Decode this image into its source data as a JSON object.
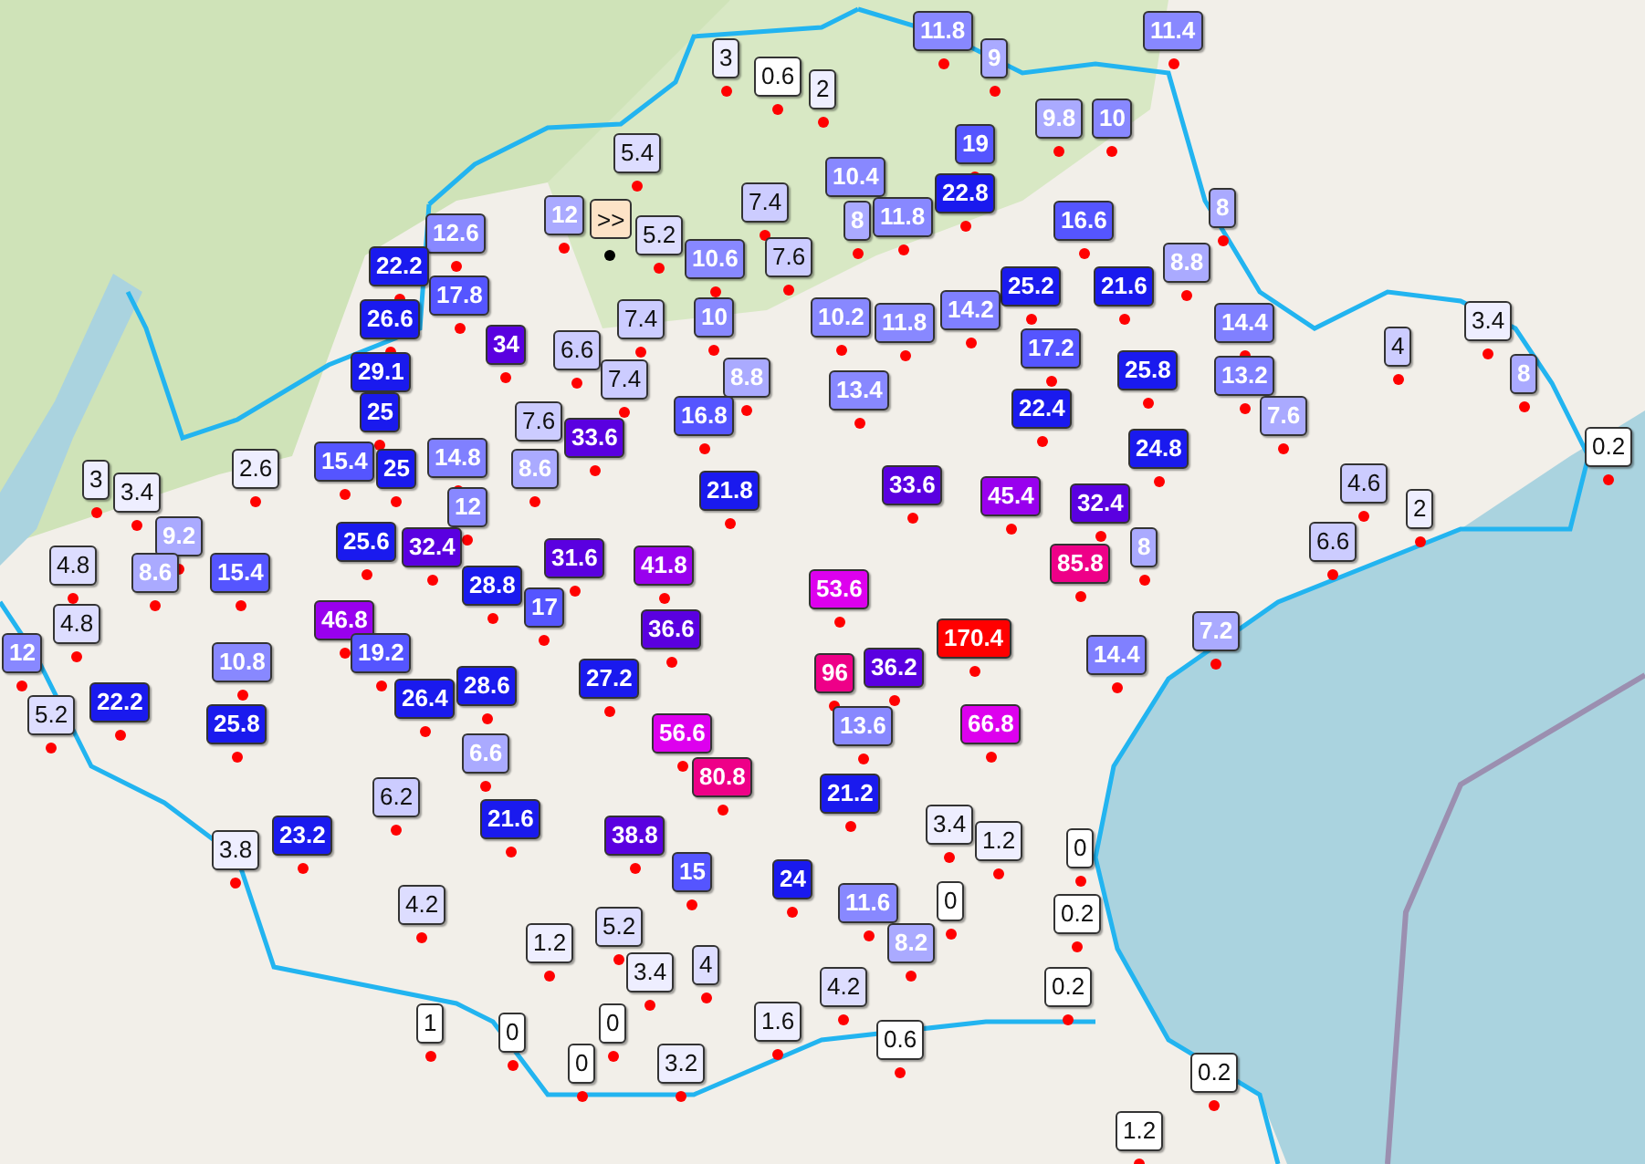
{
  "map": {
    "expand_button": {
      "label": ">>"
    },
    "markers": [
      {
        "value": "11.8",
        "color": "#8888ff"
      },
      {
        "value": "11.4",
        "color": "#8888ff"
      },
      {
        "value": "3",
        "color": "#eeeeff"
      },
      {
        "value": "0.6",
        "color": "#ffffff"
      },
      {
        "value": "9",
        "color": "#aaaaff"
      },
      {
        "value": "2",
        "color": "#eeeeff"
      },
      {
        "value": "9.8",
        "color": "#aaaaff"
      },
      {
        "value": "10",
        "color": "#8888ff"
      },
      {
        "value": "5.4",
        "color": "#ddddff"
      },
      {
        "value": "19",
        "color": "#5555ff"
      },
      {
        "value": "10.4",
        "color": "#8888ff"
      },
      {
        "value": "22.8",
        "color": "#1a1aee"
      },
      {
        "value": "12",
        "color": "#aaaaff"
      },
      {
        "value": "7.4",
        "color": "#ccccff"
      },
      {
        "value": "8",
        "color": "#aaaaff"
      },
      {
        "value": "11.8",
        "color": "#8888ff"
      },
      {
        "value": "16.6",
        "color": "#5555ff"
      },
      {
        "value": "8",
        "color": "#aaaaff"
      },
      {
        "value": "12.6",
        "color": "#8888ff"
      },
      {
        "value": "5.2",
        "color": "#ddddff"
      },
      {
        "value": "22.2",
        "color": "#1a1aee"
      },
      {
        "value": "10.6",
        "color": "#8888ff"
      },
      {
        "value": "7.6",
        "color": "#ccccff"
      },
      {
        "value": "8.8",
        "color": "#aaaaff"
      },
      {
        "value": "17.8",
        "color": "#5555ff"
      },
      {
        "value": "25.2",
        "color": "#1a1aee"
      },
      {
        "value": "21.6",
        "color": "#1a1aee"
      },
      {
        "value": "26.6",
        "color": "#1a1aee"
      },
      {
        "value": "7.4",
        "color": "#ccccff"
      },
      {
        "value": "10",
        "color": "#8888ff"
      },
      {
        "value": "10.2",
        "color": "#8888ff"
      },
      {
        "value": "11.8",
        "color": "#8888ff"
      },
      {
        "value": "14.2",
        "color": "#8080ff"
      },
      {
        "value": "14.4",
        "color": "#8080ff"
      },
      {
        "value": "3.4",
        "color": "#eeeeff"
      },
      {
        "value": "34",
        "color": "#5a00e0"
      },
      {
        "value": "6.6",
        "color": "#ccccff"
      },
      {
        "value": "17.2",
        "color": "#5555ff"
      },
      {
        "value": "4",
        "color": "#ccccff"
      },
      {
        "value": "29.1",
        "color": "#1a1aee"
      },
      {
        "value": "7.4",
        "color": "#ccccff"
      },
      {
        "value": "8.8",
        "color": "#aaaaff"
      },
      {
        "value": "13.4",
        "color": "#8888ff"
      },
      {
        "value": "25.8",
        "color": "#1a1aee"
      },
      {
        "value": "13.2",
        "color": "#8080ff"
      },
      {
        "value": "8",
        "color": "#aaaaff"
      },
      {
        "value": "25",
        "color": "#1a1aee"
      },
      {
        "value": "7.6",
        "color": "#ccccff"
      },
      {
        "value": "16.8",
        "color": "#5555ff"
      },
      {
        "value": "22.4",
        "color": "#1a1aee"
      },
      {
        "value": "7.6",
        "color": "#aaaaff"
      },
      {
        "value": "14.8",
        "color": "#8080ff"
      },
      {
        "value": "33.6",
        "color": "#5a00e0"
      },
      {
        "value": "24.8",
        "color": "#1a1aee"
      },
      {
        "value": "0.2",
        "color": "#ffffff"
      },
      {
        "value": "3",
        "color": "#eeeeff"
      },
      {
        "value": "2.6",
        "color": "#eeeeff"
      },
      {
        "value": "15.4",
        "color": "#5555ff"
      },
      {
        "value": "25",
        "color": "#1a1aee"
      },
      {
        "value": "8.6",
        "color": "#aaaaff"
      },
      {
        "value": "3.4",
        "color": "#eeeeff"
      },
      {
        "value": "21.8",
        "color": "#1a1aee"
      },
      {
        "value": "33.6",
        "color": "#5a00e0"
      },
      {
        "value": "45.4",
        "color": "#9900ee"
      },
      {
        "value": "32.4",
        "color": "#5a00e0"
      },
      {
        "value": "4.6",
        "color": "#ccccff"
      },
      {
        "value": "12",
        "color": "#8888ff"
      },
      {
        "value": "2",
        "color": "#eeeeff"
      },
      {
        "value": "9.2",
        "color": "#aaaaff"
      },
      {
        "value": "25.6",
        "color": "#1a1aee"
      },
      {
        "value": "32.4",
        "color": "#5a00e0"
      },
      {
        "value": "8",
        "color": "#aaaaff"
      },
      {
        "value": "6.6",
        "color": "#ccccff"
      },
      {
        "value": "4.8",
        "color": "#ddddff"
      },
      {
        "value": "8.6",
        "color": "#aaaaff"
      },
      {
        "value": "15.4",
        "color": "#5555ff"
      },
      {
        "value": "31.6",
        "color": "#5a00e0"
      },
      {
        "value": "41.8",
        "color": "#9900ee"
      },
      {
        "value": "85.8",
        "color": "#ee0088"
      },
      {
        "value": "28.8",
        "color": "#1a1aee"
      },
      {
        "value": "53.6",
        "color": "#dd00ee"
      },
      {
        "value": "4.8",
        "color": "#ddddff"
      },
      {
        "value": "46.8",
        "color": "#9900ee"
      },
      {
        "value": "17",
        "color": "#5555ff"
      },
      {
        "value": "36.6",
        "color": "#5a00e0"
      },
      {
        "value": "170.4",
        "color": "#ff0000"
      },
      {
        "value": "7.2",
        "color": "#aaaaff"
      },
      {
        "value": "12",
        "color": "#8888ff"
      },
      {
        "value": "10.8",
        "color": "#8888ff"
      },
      {
        "value": "19.2",
        "color": "#5555ff"
      },
      {
        "value": "96",
        "color": "#ee0088"
      },
      {
        "value": "36.2",
        "color": "#5a00e0"
      },
      {
        "value": "14.4",
        "color": "#8080ff"
      },
      {
        "value": "26.4",
        "color": "#1a1aee"
      },
      {
        "value": "28.6",
        "color": "#1a1aee"
      },
      {
        "value": "27.2",
        "color": "#1a1aee"
      },
      {
        "value": "5.2",
        "color": "#ddddff"
      },
      {
        "value": "22.2",
        "color": "#1a1aee"
      },
      {
        "value": "25.8",
        "color": "#1a1aee"
      },
      {
        "value": "56.6",
        "color": "#dd00ee"
      },
      {
        "value": "13.6",
        "color": "#8888ff"
      },
      {
        "value": "66.8",
        "color": "#dd00ee"
      },
      {
        "value": "6.6",
        "color": "#aaaaff"
      },
      {
        "value": "6.2",
        "color": "#ccccff"
      },
      {
        "value": "80.8",
        "color": "#ee0088"
      },
      {
        "value": "21.2",
        "color": "#1a1aee"
      },
      {
        "value": "23.2",
        "color": "#1a1aee"
      },
      {
        "value": "21.6",
        "color": "#1a1aee"
      },
      {
        "value": "38.8",
        "color": "#5a00e0"
      },
      {
        "value": "3.4",
        "color": "#eeeeff"
      },
      {
        "value": "3.8",
        "color": "#eeeeff"
      },
      {
        "value": "1.2",
        "color": "#eeeeff"
      },
      {
        "value": "0",
        "color": "#ffffff"
      },
      {
        "value": "15",
        "color": "#5555ff"
      },
      {
        "value": "24",
        "color": "#1a1aee"
      },
      {
        "value": "4.2",
        "color": "#ddddff"
      },
      {
        "value": "11.6",
        "color": "#8888ff"
      },
      {
        "value": "0",
        "color": "#ffffff"
      },
      {
        "value": "0.2",
        "color": "#ffffff"
      },
      {
        "value": "1.2",
        "color": "#eeeeff"
      },
      {
        "value": "5.2",
        "color": "#ddddff"
      },
      {
        "value": "8.2",
        "color": "#aaaaff"
      },
      {
        "value": "3.4",
        "color": "#eeeeff"
      },
      {
        "value": "4",
        "color": "#ddddff"
      },
      {
        "value": "4.2",
        "color": "#ddddff"
      },
      {
        "value": "0.2",
        "color": "#ffffff"
      },
      {
        "value": "1",
        "color": "#ffffff"
      },
      {
        "value": "0",
        "color": "#ffffff"
      },
      {
        "value": "0",
        "color": "#ffffff"
      },
      {
        "value": "1.6",
        "color": "#eeeeff"
      },
      {
        "value": "0.6",
        "color": "#ffffff"
      },
      {
        "value": "0",
        "color": "#ffffff"
      },
      {
        "value": "3.2",
        "color": "#eeeeff"
      },
      {
        "value": "0.2",
        "color": "#ffffff"
      },
      {
        "value": "1.2",
        "color": "#ffffff"
      }
    ]
  }
}
